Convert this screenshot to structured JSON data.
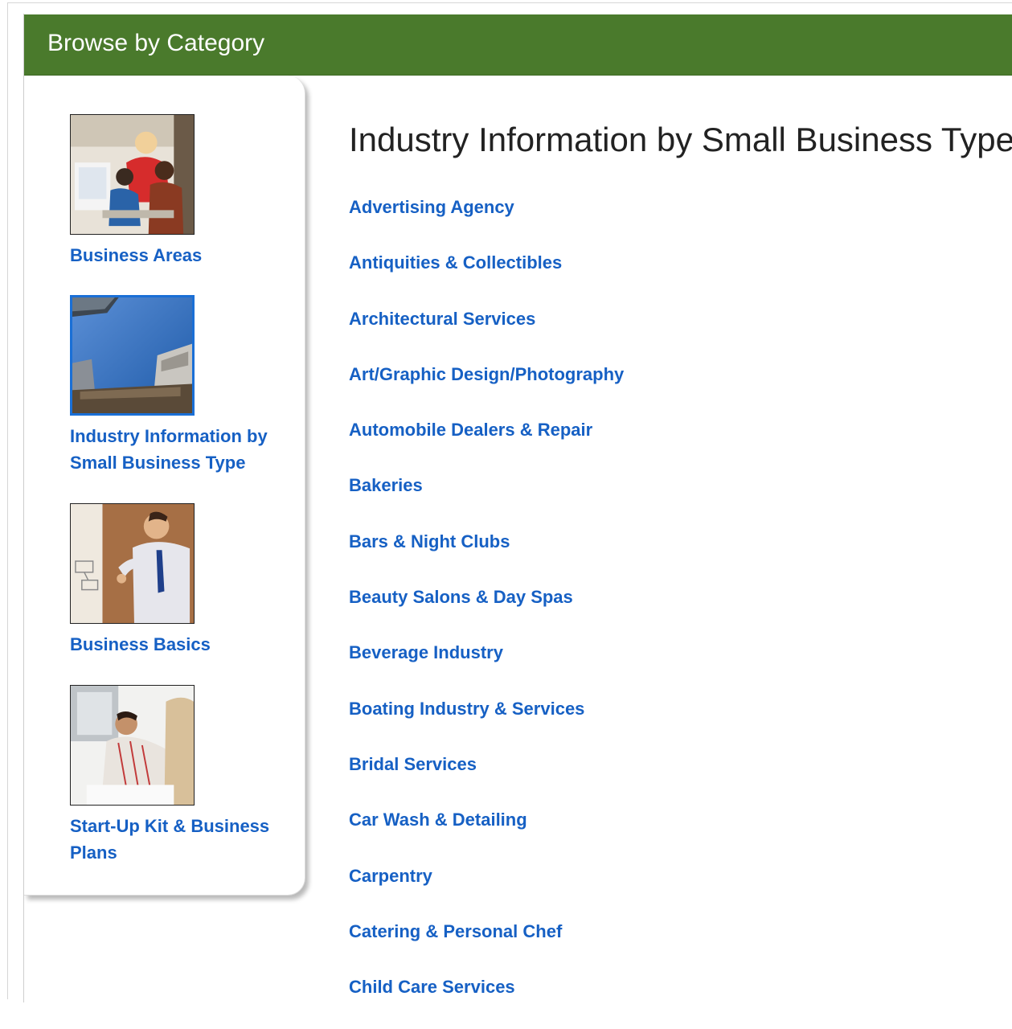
{
  "header": {
    "title": "Browse by Category"
  },
  "sidebar": {
    "items": [
      {
        "label": "Business Areas",
        "image": "office-team-photo",
        "selected": false
      },
      {
        "label": "Industry Information by Small Business Type",
        "image": "skyscrapers-sky-photo",
        "selected": true
      },
      {
        "label": "Business Basics",
        "image": "presenter-whiteboard-photo",
        "selected": false
      },
      {
        "label": "Start-Up Kit & Business Plans",
        "image": "man-writing-photo",
        "selected": false
      }
    ]
  },
  "main": {
    "title": "Industry Information by Small Business Type",
    "links": [
      "Advertising Agency",
      "Antiquities & Collectibles",
      "Architectural Services",
      "Art/Graphic Design/Photography",
      "Automobile Dealers & Repair",
      "Bakeries",
      "Bars & Night Clubs",
      "Beauty Salons & Day Spas",
      "Beverage Industry",
      "Boating Industry & Services",
      "Bridal Services",
      "Car Wash & Detailing",
      "Carpentry",
      "Catering & Personal Chef",
      "Child Care Services"
    ]
  },
  "colors": {
    "header_bg": "#4a7a2c",
    "link": "#1660c4",
    "selected_border": "#1a6fd6"
  }
}
